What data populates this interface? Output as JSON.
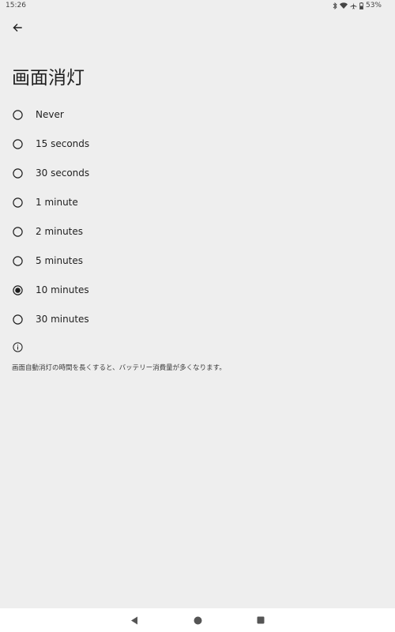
{
  "status_bar": {
    "time": "15:26",
    "battery": "53%",
    "icons": [
      "bluetooth-icon",
      "wifi-icon",
      "airplane-icon",
      "battery-icon"
    ]
  },
  "header": {
    "back_icon": "arrow-back-icon",
    "title": "画面消灯"
  },
  "options": [
    {
      "label": "Never",
      "selected": false
    },
    {
      "label": "15 seconds",
      "selected": false
    },
    {
      "label": "30 seconds",
      "selected": false
    },
    {
      "label": "1 minute",
      "selected": false
    },
    {
      "label": "2 minutes",
      "selected": false
    },
    {
      "label": "5 minutes",
      "selected": false
    },
    {
      "label": "10 minutes",
      "selected": true
    },
    {
      "label": "30 minutes",
      "selected": false
    }
  ],
  "footer": {
    "info_icon": "info-icon",
    "note": "画面自動消灯の時間を長くすると、バッテリー消費量が多くなります。"
  },
  "nav_bar": {
    "buttons": [
      "back-triangle-icon",
      "home-circle-icon",
      "recents-square-icon"
    ]
  },
  "colors": {
    "background": "#eeeeee",
    "text": "#1f1f1f",
    "radio": "#1f1f1f",
    "nav_bg": "#ffffff"
  }
}
